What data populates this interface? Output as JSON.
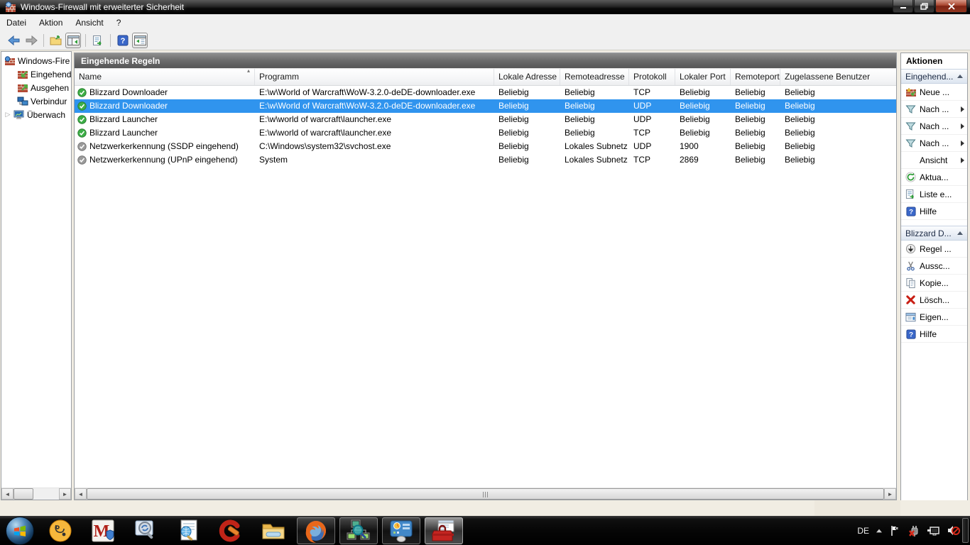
{
  "window": {
    "title": "Windows-Firewall mit erweiterter Sicherheit",
    "controls": [
      "minimize",
      "restore",
      "close"
    ]
  },
  "menubar": {
    "items": [
      "Datei",
      "Aktion",
      "Ansicht",
      "?"
    ]
  },
  "toolbar": {
    "buttons": [
      "back",
      "forward",
      "export",
      "show-console-tree",
      "export-list",
      "help",
      "show-action-pane"
    ]
  },
  "tree": {
    "items": [
      {
        "label": "Windows-Fire",
        "icon": "firewall-icon"
      },
      {
        "label": "Eingehend",
        "icon": "inbound-rules-icon"
      },
      {
        "label": "Ausgehen",
        "icon": "outbound-rules-icon"
      },
      {
        "label": "Verbindur",
        "icon": "connection-security-icon"
      },
      {
        "label": "Überwach",
        "icon": "monitoring-icon"
      }
    ]
  },
  "main": {
    "title": "Eingehende Regeln",
    "columns": [
      "Name",
      "Programm",
      "Lokale Adresse",
      "Remoteadresse",
      "Protokoll",
      "Lokaler Port",
      "Remoteport",
      "Zugelassene Benutzer"
    ],
    "rows": [
      {
        "name": "Blizzard Downloader",
        "program": "E:\\w\\World of Warcraft\\WoW-3.2.0-deDE-downloader.exe",
        "local_address": "Beliebig",
        "remote_address": "Beliebig",
        "protocol": "TCP",
        "local_port": "Beliebig",
        "remote_port": "Beliebig",
        "allowed_users": "Beliebig",
        "enabled": true,
        "selected": false
      },
      {
        "name": "Blizzard Downloader",
        "program": "E:\\w\\World of Warcraft\\WoW-3.2.0-deDE-downloader.exe",
        "local_address": "Beliebig",
        "remote_address": "Beliebig",
        "protocol": "UDP",
        "local_port": "Beliebig",
        "remote_port": "Beliebig",
        "allowed_users": "Beliebig",
        "enabled": true,
        "selected": true
      },
      {
        "name": "Blizzard Launcher",
        "program": "E:\\w\\world of warcraft\\launcher.exe",
        "local_address": "Beliebig",
        "remote_address": "Beliebig",
        "protocol": "UDP",
        "local_port": "Beliebig",
        "remote_port": "Beliebig",
        "allowed_users": "Beliebig",
        "enabled": true,
        "selected": false
      },
      {
        "name": "Blizzard Launcher",
        "program": "E:\\w\\world of warcraft\\launcher.exe",
        "local_address": "Beliebig",
        "remote_address": "Beliebig",
        "protocol": "TCP",
        "local_port": "Beliebig",
        "remote_port": "Beliebig",
        "allowed_users": "Beliebig",
        "enabled": true,
        "selected": false
      },
      {
        "name": "Netzwerkerkennung (SSDP eingehend)",
        "program": "C:\\Windows\\system32\\svchost.exe",
        "local_address": "Beliebig",
        "remote_address": "Lokales Subnetz",
        "protocol": "UDP",
        "local_port": "1900",
        "remote_port": "Beliebig",
        "allowed_users": "Beliebig",
        "enabled": false,
        "selected": false
      },
      {
        "name": "Netzwerkerkennung (UPnP eingehend)",
        "program": "System",
        "local_address": "Beliebig",
        "remote_address": "Lokales Subnetz",
        "protocol": "TCP",
        "local_port": "2869",
        "remote_port": "Beliebig",
        "allowed_users": "Beliebig",
        "enabled": false,
        "selected": false
      }
    ]
  },
  "actions": {
    "title": "Aktionen",
    "groups": [
      {
        "header": "Eingehend...",
        "items": [
          {
            "label": "Neue ...",
            "icon": "new-rule-icon",
            "submenu": false
          },
          {
            "label": "Nach ...",
            "icon": "filter-icon",
            "submenu": true
          },
          {
            "label": "Nach ...",
            "icon": "filter-icon",
            "submenu": true
          },
          {
            "label": "Nach ...",
            "icon": "filter-icon",
            "submenu": true
          },
          {
            "label": "Ansicht",
            "icon": "",
            "submenu": true
          },
          {
            "label": "Aktua...",
            "icon": "refresh-icon",
            "submenu": false
          },
          {
            "label": "Liste e...",
            "icon": "export-list-icon",
            "submenu": false
          },
          {
            "label": "Hilfe",
            "icon": "help-icon",
            "submenu": false
          }
        ]
      },
      {
        "header": "Blizzard D...",
        "items": [
          {
            "label": "Regel ...",
            "icon": "disable-rule-icon",
            "submenu": false
          },
          {
            "label": "Aussc...",
            "icon": "cut-icon",
            "submenu": false
          },
          {
            "label": "Kopie...",
            "icon": "copy-icon",
            "submenu": false
          },
          {
            "label": "Lösch...",
            "icon": "delete-icon",
            "submenu": false
          },
          {
            "label": "Eigen...",
            "icon": "properties-icon",
            "submenu": false
          },
          {
            "label": "Hilfe",
            "icon": "help-icon",
            "submenu": false
          }
        ]
      }
    ]
  },
  "taskbar": {
    "start": "start-orb",
    "apps": [
      {
        "icon": "stethoscope-app-icon",
        "running": false
      },
      {
        "icon": "antivirus-m-shield-icon",
        "running": false
      },
      {
        "icon": "search-update-icon",
        "running": false
      },
      {
        "icon": "network-report-icon",
        "running": false
      },
      {
        "icon": "ccleaner-icon",
        "running": false
      },
      {
        "icon": "explorer-folder-icon",
        "running": false
      },
      {
        "icon": "firefox-icon",
        "running": true
      },
      {
        "icon": "network-scan-icon",
        "running": true
      },
      {
        "icon": "display-settings-icon",
        "running": true
      },
      {
        "icon": "toolbox-icon",
        "running": true,
        "active": true
      }
    ],
    "tray": {
      "language": "DE",
      "icons": [
        "hidden-icons-chevron",
        "action-center-flag",
        "power-plug-error",
        "network-status",
        "volume-muted"
      ]
    }
  },
  "colors": {
    "selection": "#3094EE",
    "panel_title_gradient": "#6b6b6b",
    "enabled_rule": "#3daf47",
    "disabled_rule": "#9b9b9b",
    "taskbar": "#000000"
  }
}
